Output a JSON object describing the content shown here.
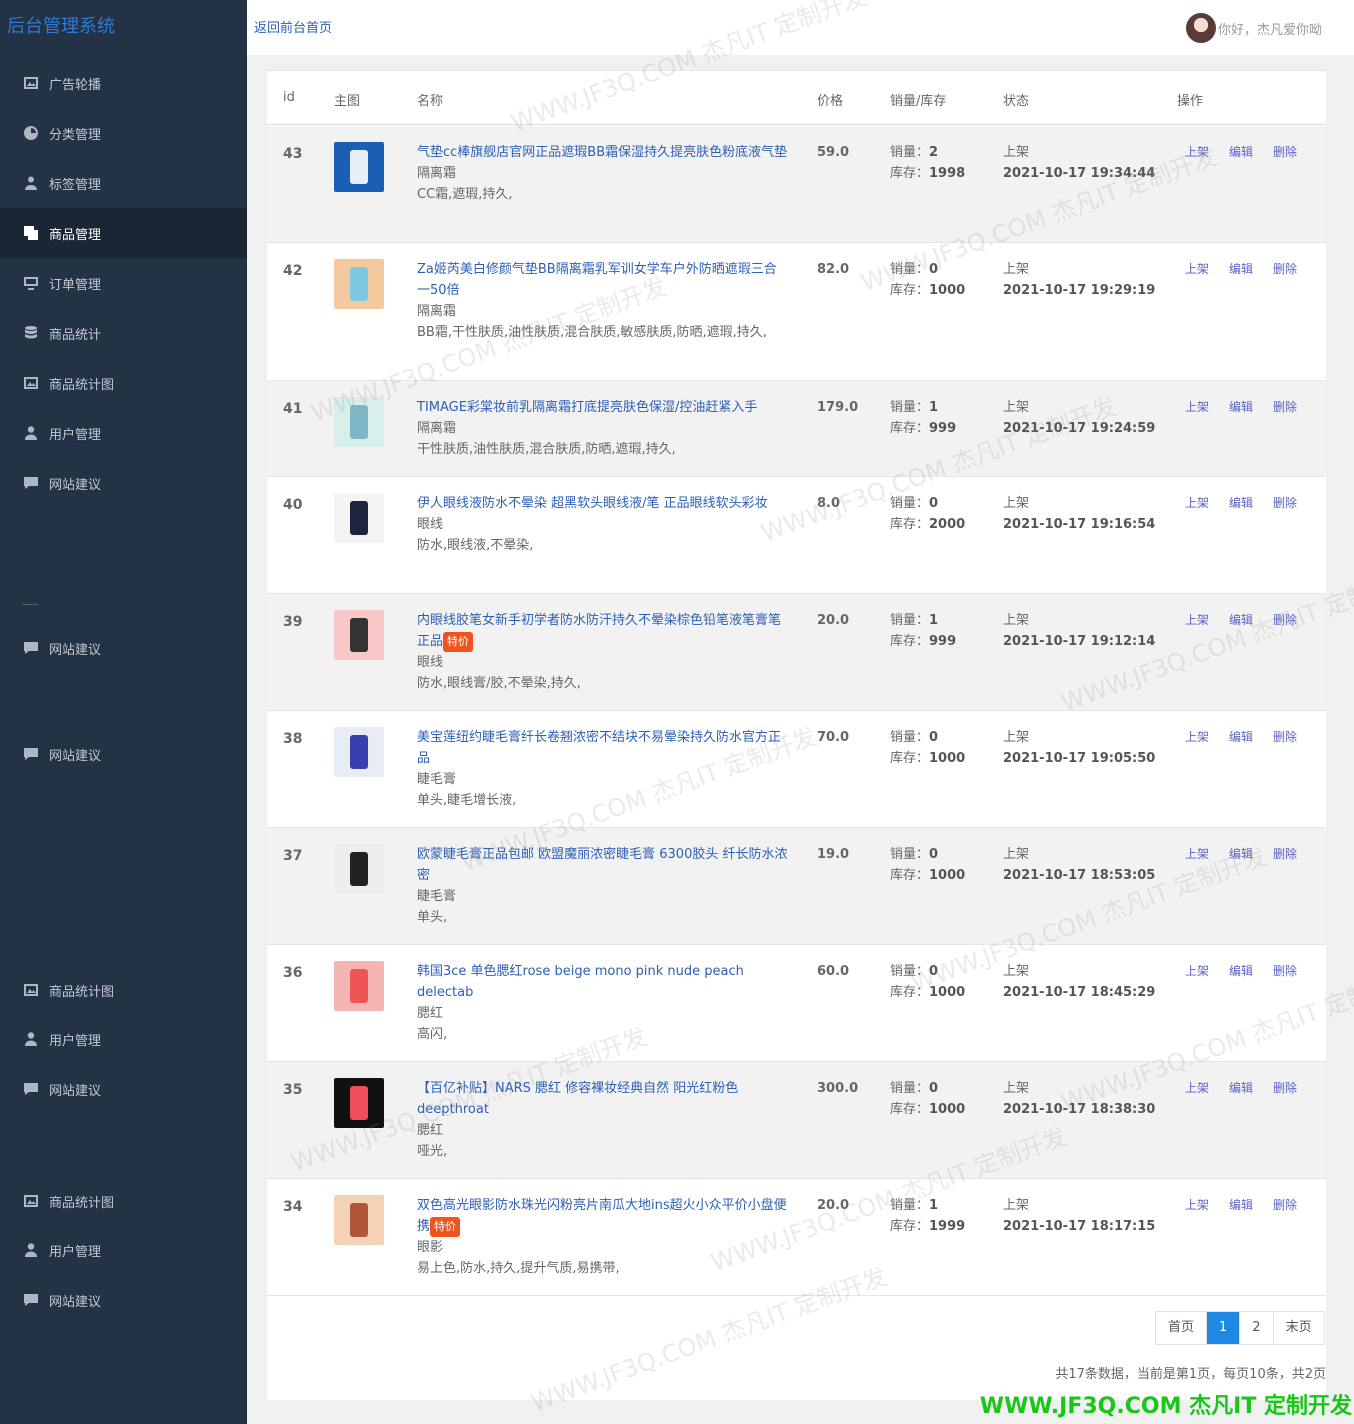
{
  "sidebar": {
    "brand": "后台管理系统",
    "items": [
      {
        "label": "广告轮播",
        "icon": "image-icon"
      },
      {
        "label": "分类管理",
        "icon": "dashboard-icon"
      },
      {
        "label": "标签管理",
        "icon": "user-tag-icon"
      },
      {
        "label": "商品管理",
        "icon": "copy-icon",
        "active": true
      },
      {
        "label": "订单管理",
        "icon": "monitor-icon"
      },
      {
        "label": "商品统计",
        "icon": "database-icon"
      },
      {
        "label": "商品统计图",
        "icon": "image-icon"
      },
      {
        "label": "用户管理",
        "icon": "user-icon"
      },
      {
        "label": "网站建议",
        "icon": "comment-icon"
      },
      {
        "label": "网站建议",
        "icon": "comment-icon"
      },
      {
        "label": "网站建议",
        "icon": "comment-icon"
      },
      {
        "label": "商品统计图",
        "icon": "image-icon"
      },
      {
        "label": "用户管理",
        "icon": "user-icon"
      },
      {
        "label": "网站建议",
        "icon": "comment-icon"
      },
      {
        "label": "商品统计图",
        "icon": "image-icon"
      },
      {
        "label": "用户管理",
        "icon": "user-icon"
      },
      {
        "label": "网站建议",
        "icon": "comment-icon"
      }
    ]
  },
  "header": {
    "back_link": "返回前台首页",
    "greeting": "你好，杰凡爱你呦"
  },
  "table": {
    "headers": {
      "id": "id",
      "image": "主图",
      "name": "名称",
      "price": "价格",
      "sales_stock": "销量/库存",
      "status": "状态",
      "ops": "操作"
    },
    "sales_label": "销量：",
    "stock_label": "库存：",
    "ops": {
      "on": "上架",
      "edit": "编辑",
      "delete": "删除"
    },
    "badge": "特价",
    "rows": [
      {
        "id": "43",
        "name": "气垫cc棒旗舰店官网正品遮瑕BB霜保湿持久提亮肤色粉底液气垫",
        "cat": "隔离霜",
        "tags": "CC霜,遮瑕,持久,",
        "price": "59.0",
        "sales": "2",
        "stock": "1998",
        "status": "上架",
        "time": "2021-10-17 19:34:44",
        "special": false
      },
      {
        "id": "42",
        "name": "Za姬芮美白修颜气垫BB隔离霜乳军训女学车户外防晒遮瑕三合一50倍",
        "cat": "隔离霜",
        "tags": "BB霜,干性肤质,油性肤质,混合肤质,敏感肤质,防晒,遮瑕,持久,",
        "price": "82.0",
        "sales": "0",
        "stock": "1000",
        "status": "上架",
        "time": "2021-10-17 19:29:19",
        "special": false
      },
      {
        "id": "41",
        "name": "TIMAGE彩棠妆前乳隔离霜打底提亮肤色保湿/控油赶紧入手",
        "cat": "隔离霜",
        "tags": "干性肤质,油性肤质,混合肤质,防晒,遮瑕,持久,",
        "price": "179.0",
        "sales": "1",
        "stock": "999",
        "status": "上架",
        "time": "2021-10-17 19:24:59",
        "special": false
      },
      {
        "id": "40",
        "name": "伊人眼线液防水不晕染 超黑软头眼线液/笔 正品眼线软头彩妆",
        "cat": "眼线",
        "tags": "防水,眼线液,不晕染,",
        "price": "8.0",
        "sales": "0",
        "stock": "2000",
        "status": "上架",
        "time": "2021-10-17 19:16:54",
        "special": false
      },
      {
        "id": "39",
        "name": "内眼线胶笔女新手初学者防水防汗持久不晕染棕色铅笔液笔膏笔正品",
        "cat": "眼线",
        "tags": "防水,眼线膏/胶,不晕染,持久,",
        "price": "20.0",
        "sales": "1",
        "stock": "999",
        "status": "上架",
        "time": "2021-10-17 19:12:14",
        "special": true
      },
      {
        "id": "38",
        "name": "美宝莲纽约睫毛膏纤长卷翘浓密不结块不易晕染持久防水官方正品",
        "cat": "睫毛膏",
        "tags": "单头,睫毛增长液,",
        "price": "70.0",
        "sales": "0",
        "stock": "1000",
        "status": "上架",
        "time": "2021-10-17 19:05:50",
        "special": false
      },
      {
        "id": "37",
        "name": "欧蒙睫毛膏正品包邮 欧盟魔丽浓密睫毛膏 6300胶头 纤长防水浓密",
        "cat": "睫毛膏",
        "tags": "单头,",
        "price": "19.0",
        "sales": "0",
        "stock": "1000",
        "status": "上架",
        "time": "2021-10-17 18:53:05",
        "special": false
      },
      {
        "id": "36",
        "name": "韩国3ce 单色腮红rose beige mono pink nude peach delectab",
        "cat": "腮红",
        "tags": "高闪,",
        "price": "60.0",
        "sales": "0",
        "stock": "1000",
        "status": "上架",
        "time": "2021-10-17 18:45:29",
        "special": false
      },
      {
        "id": "35",
        "name": "【百亿补贴】NARS 腮红 修容裸妆经典自然 阳光红粉色deepthroat",
        "cat": "腮红",
        "tags": "哑光,",
        "price": "300.0",
        "sales": "0",
        "stock": "1000",
        "status": "上架",
        "time": "2021-10-17 18:38:30",
        "special": false
      },
      {
        "id": "34",
        "name": "双色高光眼影防水珠光闪粉亮片南瓜大地ins超火小众平价小盘便携",
        "cat": "眼影",
        "tags": "易上色,防水,持久,提升气质,易携带,",
        "price": "20.0",
        "sales": "1",
        "stock": "1999",
        "status": "上架",
        "time": "2021-10-17 18:17:15",
        "special": true
      }
    ]
  },
  "pagination": {
    "first": "首页",
    "pages": [
      "1",
      "2"
    ],
    "current": "1",
    "last": "末页",
    "summary": "共17条数据，当前是第1页，每页10条，共2页"
  },
  "watermark": {
    "footer": "WWW.JF3Q.COM 杰凡IT  定制开发",
    "text": "WWW.JF3Q.COM 杰凡IT 定制开发"
  },
  "colors": {
    "sidebar_bg": "#233244",
    "link": "#2d5fb4",
    "badge": "#f0541e",
    "pager_active": "#1e88e5",
    "footer_watermark": "#19c619"
  }
}
